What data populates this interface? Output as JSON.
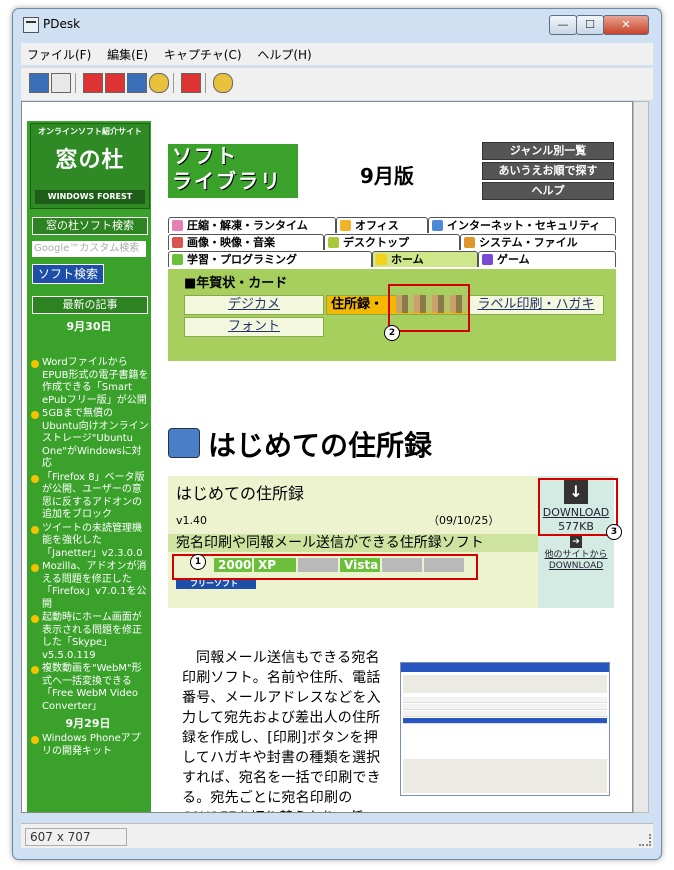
{
  "window": {
    "title": "PDesk",
    "min": "—",
    "max": "☐",
    "close": "✕"
  },
  "menu": [
    "ファイル(F)",
    "編集(E)",
    "キャプチャ(C)",
    "ヘルプ(H)"
  ],
  "status": {
    "size": "607 x 707"
  },
  "sidebar": {
    "logo_top": "オンラインソフト紹介サイト",
    "logo_main": "窓の杜",
    "logo_bottom": "WINDOWS FOREST",
    "search_title": "窓の杜ソフト検索",
    "search_placeholder": "Google™カスタム検索",
    "search_button": "ソフト検索",
    "latest": "最新の記事",
    "date1": "9月30日",
    "date2": "9月29日",
    "news": [
      "Wordファイルから EPUB形式の電子書籍を作成できる「Smart ePubフリー版」が公開",
      "5GBまで無償のUbuntu向けオンラインストレージ\"Ubuntu One\"がWindowsに対応",
      "「Firefox 8」ベータ版が公開、ユーザーの意思に反するアドオンの追加をブロック",
      "ツイートの未読管理機能を強化した「Janetter」v2.3.0.0",
      "Mozilla、アドオンが消える問題を修正した「Firefox」v7.0.1を公開",
      "起動時にホーム画面が表示される問題を修正した「Skype」v5.5.0.119",
      "複数動画を\"WebM\"形式へ一括変換できる「Free WebM Video Converter」",
      "Windows Phoneアプリの開発キット"
    ]
  },
  "header": {
    "soft_line1": "ソフト",
    "soft_line2": "ライブラリ",
    "month": "9月版",
    "buttons": [
      "ジャンル別一覧",
      "あいうえお順で探す",
      "ヘルプ"
    ]
  },
  "tabs": {
    "row1": [
      "圧縮・解凍・ランタイム",
      "オフィス",
      "インターネット・セキュリティ"
    ],
    "row2": [
      "画像・映像・音楽",
      "デスクトップ",
      "システム・ファイル"
    ],
    "row3": [
      "学習・プログラミング",
      "ホーム",
      "ゲーム"
    ]
  },
  "category": {
    "heading": "■年賀状・カード",
    "items": [
      "デジカメ",
      "住所録・",
      "ラベル印刷・ハガキ",
      "フォント"
    ]
  },
  "app": {
    "heading": "はじめての住所録",
    "name": "はじめての住所録",
    "version": "v1.40",
    "date": "（09/10/25）",
    "description": "宛名印刷や同報メール送信ができる住所録ソフト",
    "os": [
      "2000",
      "XP",
      "",
      "Vista",
      "",
      ""
    ],
    "license": "フリーソフト",
    "download_label": "DOWNLOAD",
    "download_size": "577KB",
    "other_sites": "他のサイトから DOWNLOAD",
    "callouts": [
      "1",
      "2",
      "3"
    ]
  },
  "body_text": "同報メール送信もできる宛名印刷ソフト。名前や住所、電話番号、メールアドレスなどを入力して宛先および差出人の住所録を作成し、[印刷]ボタンを押してハガキや封書の種類を選択すれば、宛名を一括で印刷できる。宛先ごとに宛名印刷のON/OFFを切り替えたり、任"
}
